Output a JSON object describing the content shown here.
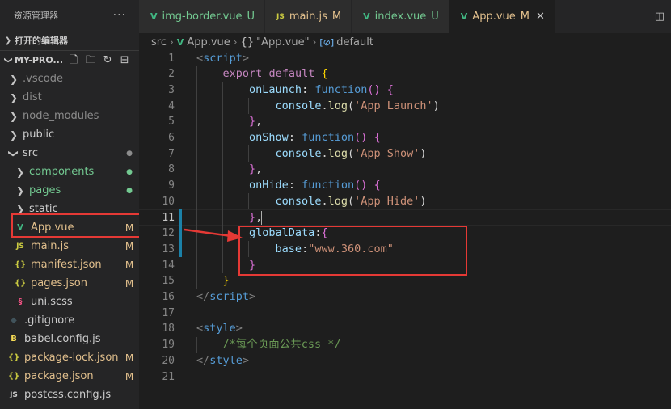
{
  "sidebar": {
    "title": "资源管理器",
    "more": "···",
    "open_editors": "打开的编辑器",
    "project": "MY-PRO...",
    "items": [
      {
        "name": ".vscode",
        "kind": "folder",
        "depth": 0,
        "expanded": false,
        "color": "grey"
      },
      {
        "name": "dist",
        "kind": "folder",
        "depth": 0,
        "expanded": false,
        "color": "grey"
      },
      {
        "name": "node_modules",
        "kind": "folder",
        "depth": 0,
        "expanded": false,
        "color": "grey"
      },
      {
        "name": "public",
        "kind": "folder",
        "depth": 0,
        "expanded": false,
        "color": "light"
      },
      {
        "name": "src",
        "kind": "folder",
        "depth": 0,
        "expanded": true,
        "color": "light",
        "dot": "●"
      },
      {
        "name": "components",
        "kind": "folder",
        "depth": 1,
        "expanded": false,
        "color": "green",
        "dot": "●"
      },
      {
        "name": "pages",
        "kind": "folder",
        "depth": 1,
        "expanded": false,
        "color": "green",
        "dot": "●"
      },
      {
        "name": "static",
        "kind": "folder",
        "depth": 1,
        "expanded": false,
        "color": "light"
      },
      {
        "name": "App.vue",
        "kind": "vue",
        "depth": 1,
        "color": "mod",
        "badge": "M"
      },
      {
        "name": "main.js",
        "kind": "js",
        "depth": 1,
        "color": "mod",
        "badge": "M"
      },
      {
        "name": "manifest.json",
        "kind": "json",
        "depth": 1,
        "color": "mod",
        "badge": "M"
      },
      {
        "name": "pages.json",
        "kind": "json",
        "depth": 1,
        "color": "mod",
        "badge": "M"
      },
      {
        "name": "uni.scss",
        "kind": "sass",
        "depth": 1,
        "color": "light"
      },
      {
        "name": ".gitignore",
        "kind": "git",
        "depth": 0,
        "color": "light"
      },
      {
        "name": "babel.config.js",
        "kind": "babel",
        "depth": 0,
        "color": "light"
      },
      {
        "name": "package-lock.json",
        "kind": "json",
        "depth": 0,
        "color": "mod",
        "badge": "M"
      },
      {
        "name": "package.json",
        "kind": "json",
        "depth": 0,
        "color": "mod",
        "badge": "M"
      },
      {
        "name": "postcss.config.js",
        "kind": "postcss",
        "depth": 0,
        "color": "light"
      }
    ]
  },
  "tabs": [
    {
      "name": "img-border.vue",
      "state": "U",
      "icon": "vue",
      "active": false
    },
    {
      "name": "main.js",
      "state": "M",
      "icon": "js",
      "active": false
    },
    {
      "name": "index.vue",
      "state": "U",
      "icon": "vue",
      "active": false
    },
    {
      "name": "App.vue",
      "state": "M",
      "icon": "vue",
      "active": true
    }
  ],
  "breadcrumb": {
    "folder": "src",
    "file": "App.vue",
    "object": "\"App.vue\"",
    "symbol": "default"
  },
  "code": {
    "current_line": 11,
    "lines": [
      [
        [
          "k-punct",
          "<"
        ],
        [
          "k-tag",
          "script"
        ],
        [
          "k-punct",
          ">"
        ]
      ],
      [
        [
          "k-plain",
          "    "
        ],
        [
          "k-kw",
          "export"
        ],
        [
          "k-plain",
          " "
        ],
        [
          "k-kw",
          "default"
        ],
        [
          "k-plain",
          " "
        ],
        [
          "k-br",
          "{"
        ]
      ],
      [
        [
          "k-plain",
          "        "
        ],
        [
          "k-prop",
          "onLaunch"
        ],
        [
          "k-plain",
          ": "
        ],
        [
          "k-key",
          "function"
        ],
        [
          "k-br2",
          "()"
        ],
        [
          "k-plain",
          " "
        ],
        [
          "k-br2",
          "{"
        ]
      ],
      [
        [
          "k-plain",
          "            "
        ],
        [
          "k-prop",
          "console"
        ],
        [
          "k-plain",
          "."
        ],
        [
          "k-fn",
          "log"
        ],
        [
          "k-plain",
          "("
        ],
        [
          "k-str",
          "'App Launch'"
        ],
        [
          "k-plain",
          ")"
        ]
      ],
      [
        [
          "k-plain",
          "        "
        ],
        [
          "k-br2",
          "}"
        ],
        [
          "k-plain",
          ","
        ]
      ],
      [
        [
          "k-plain",
          "        "
        ],
        [
          "k-prop",
          "onShow"
        ],
        [
          "k-plain",
          ": "
        ],
        [
          "k-key",
          "function"
        ],
        [
          "k-br2",
          "()"
        ],
        [
          "k-plain",
          " "
        ],
        [
          "k-br2",
          "{"
        ]
      ],
      [
        [
          "k-plain",
          "            "
        ],
        [
          "k-prop",
          "console"
        ],
        [
          "k-plain",
          "."
        ],
        [
          "k-fn",
          "log"
        ],
        [
          "k-plain",
          "("
        ],
        [
          "k-str",
          "'App Show'"
        ],
        [
          "k-plain",
          ")"
        ]
      ],
      [
        [
          "k-plain",
          "        "
        ],
        [
          "k-br2",
          "}"
        ],
        [
          "k-plain",
          ","
        ]
      ],
      [
        [
          "k-plain",
          "        "
        ],
        [
          "k-prop",
          "onHide"
        ],
        [
          "k-plain",
          ": "
        ],
        [
          "k-key",
          "function"
        ],
        [
          "k-br2",
          "()"
        ],
        [
          "k-plain",
          " "
        ],
        [
          "k-br2",
          "{"
        ]
      ],
      [
        [
          "k-plain",
          "            "
        ],
        [
          "k-prop",
          "console"
        ],
        [
          "k-plain",
          "."
        ],
        [
          "k-fn",
          "log"
        ],
        [
          "k-plain",
          "("
        ],
        [
          "k-str",
          "'App Hide'"
        ],
        [
          "k-plain",
          ")"
        ]
      ],
      [
        [
          "k-plain",
          "        "
        ],
        [
          "k-br2",
          "}"
        ],
        [
          "k-plain",
          ","
        ]
      ],
      [
        [
          "k-plain",
          "        "
        ],
        [
          "k-prop",
          "globalData"
        ],
        [
          "k-plain",
          ":"
        ],
        [
          "k-br2",
          "{"
        ]
      ],
      [
        [
          "k-plain",
          "            "
        ],
        [
          "k-prop",
          "base"
        ],
        [
          "k-plain",
          ":"
        ],
        [
          "k-str",
          "\"www.360.com\""
        ]
      ],
      [
        [
          "k-plain",
          "        "
        ],
        [
          "k-br2",
          "}"
        ]
      ],
      [
        [
          "k-plain",
          "    "
        ],
        [
          "k-br",
          "}"
        ]
      ],
      [
        [
          "k-punct",
          "</"
        ],
        [
          "k-tag",
          "script"
        ],
        [
          "k-punct",
          ">"
        ]
      ],
      [],
      [
        [
          "k-punct",
          "<"
        ],
        [
          "k-tag",
          "style"
        ],
        [
          "k-punct",
          ">"
        ]
      ],
      [
        [
          "k-plain",
          "    "
        ],
        [
          "k-cmt",
          "/*每个页面公共css */"
        ]
      ],
      [
        [
          "k-punct",
          "</"
        ],
        [
          "k-tag",
          "style"
        ],
        [
          "k-punct",
          ">"
        ]
      ],
      []
    ]
  }
}
